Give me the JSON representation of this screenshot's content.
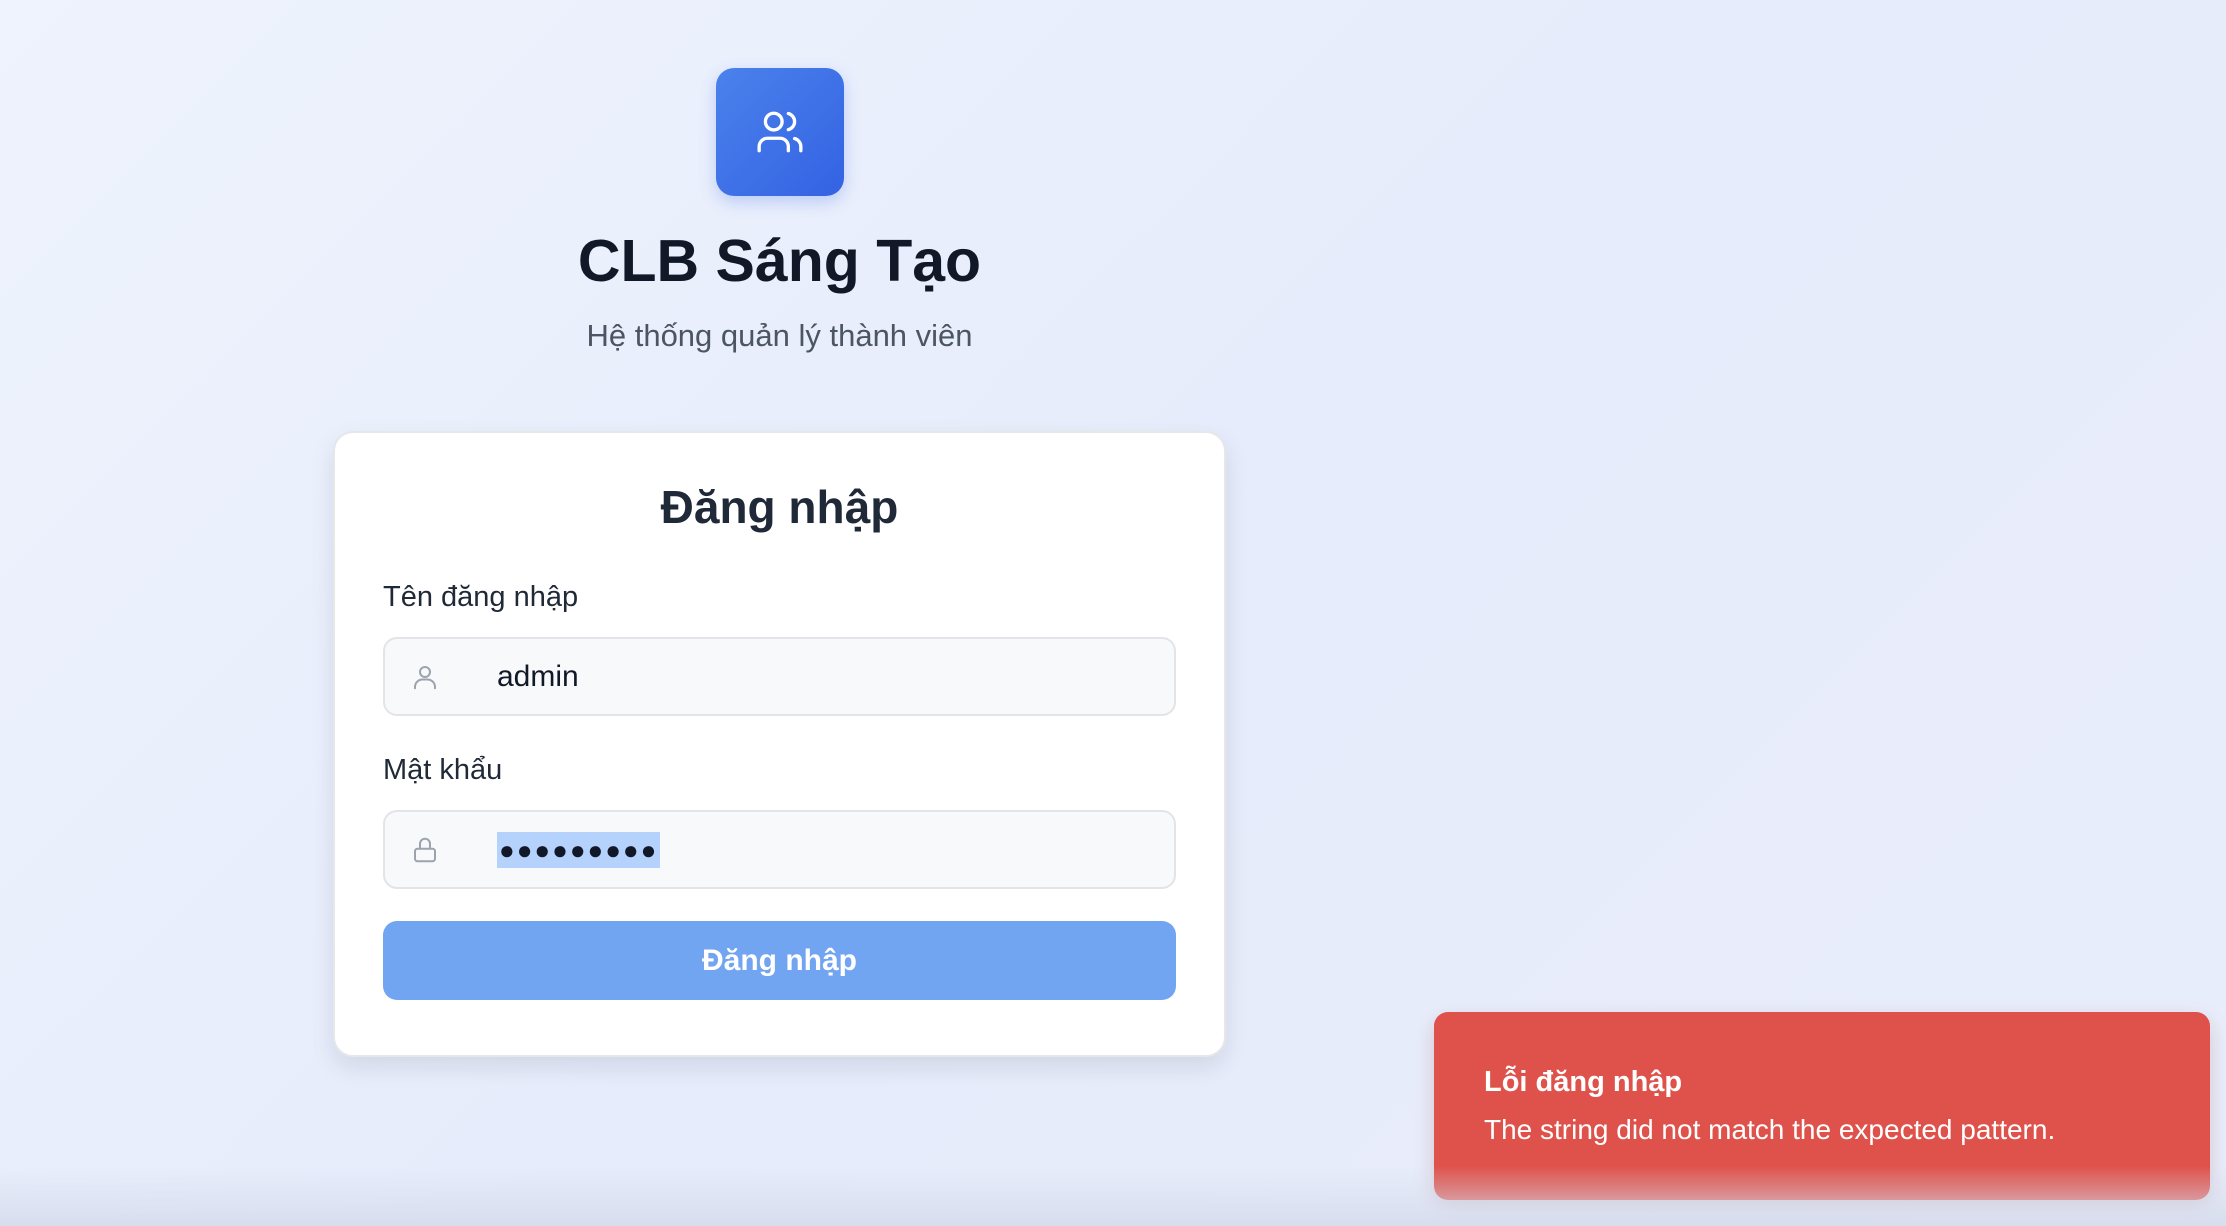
{
  "app": {
    "title": "CLB Sáng Tạo",
    "subtitle": "Hệ thống quản lý thành viên",
    "logo_icon": "users-icon"
  },
  "login_form": {
    "title": "Đăng nhập",
    "username": {
      "label": "Tên đăng nhập",
      "value": "admin",
      "icon": "user-icon"
    },
    "password": {
      "label": "Mật khẩu",
      "masked_value": "●●●●●●●●●",
      "icon": "lock-icon",
      "selected": true
    },
    "submit_label": "Đăng nhập"
  },
  "toast": {
    "title": "Lỗi đăng nhập",
    "message": "The string did not match the expected pattern.",
    "color": "#de524b"
  },
  "colors": {
    "brand": "#3b6fe8",
    "button": "#72a5f1",
    "selection": "#b4d2fb"
  }
}
